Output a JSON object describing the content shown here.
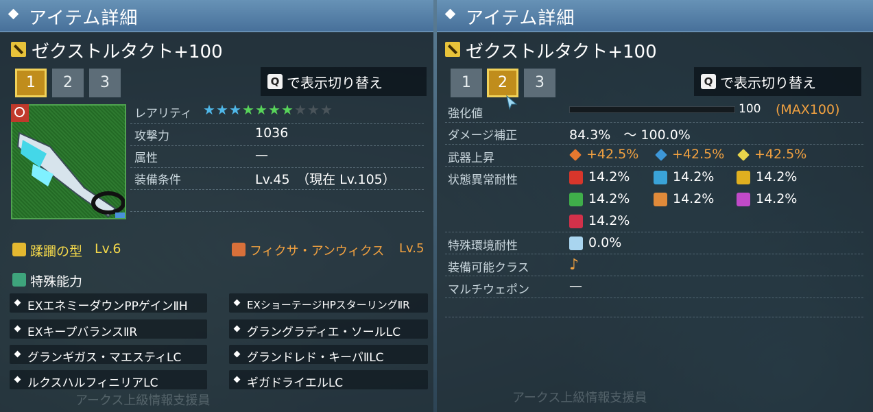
{
  "header": {
    "title": "アイテム詳細"
  },
  "item": {
    "name": "ゼクストルタクト+100"
  },
  "tabs": [
    "1",
    "2",
    "3"
  ],
  "toggle": {
    "key": "Q",
    "text": "で表示切り替え"
  },
  "left": {
    "rarity_label": "レアリティ",
    "rarity": {
      "filled": 7,
      "total": 10,
      "colors": [
        "#4fb7e8",
        "#4fb7e8",
        "#4fb7e8",
        "#58d45a",
        "#58d45a",
        "#58d45a",
        "#58d45a"
      ]
    },
    "stats": [
      {
        "label": "攻撃力",
        "value": "1036"
      },
      {
        "label": "属性",
        "value": "—"
      },
      {
        "label": "装備条件",
        "value": "Lv.45　（現在  Lv.105）"
      }
    ],
    "potential": {
      "name": "蹂躙の型",
      "level": "Lv.6"
    },
    "affix": {
      "name": "フィクサ・アンウィクス",
      "level": "Lv.5"
    },
    "special_label": "特殊能力",
    "abilities": [
      "EXエネミーダウンPPゲインⅡH",
      "EXショーテージHPスターリングⅡR",
      "EXキープバランスⅡR",
      "グラングラディエ・ソールLC",
      "グランギガス・マエスティLC",
      "グランドレド・キーパⅡLC",
      "ルクスハルフィニリアLC",
      "ギガドライエルLC"
    ],
    "watermark": "アークス上級情報支援員"
  },
  "right": {
    "rows": [
      {
        "label": "強化値",
        "value": "100",
        "extra": "(MAX100)"
      },
      {
        "label": "ダメージ補正",
        "value": "84.3%　～ 100.0%"
      },
      {
        "label": "武器上昇",
        "values": [
          "+42.5%",
          "+42.5%",
          "+42.5%"
        ]
      },
      {
        "label": "状態異常耐性",
        "values": [
          "14.2%",
          "14.2%",
          "14.2%",
          "14.2%",
          "14.2%",
          "14.2%",
          "14.2%"
        ]
      },
      {
        "label": "特殊環境耐性",
        "value": "0.0%"
      },
      {
        "label": "装備可能クラス",
        "value": "♪"
      },
      {
        "label": "マルチウェポン",
        "value": "—"
      }
    ],
    "watermark": "アークス上級情報支援員"
  }
}
